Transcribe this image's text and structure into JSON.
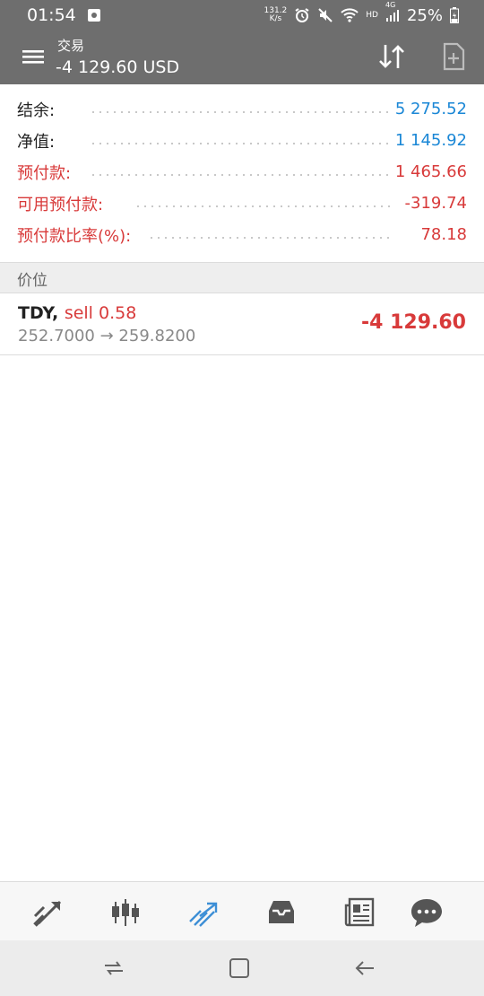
{
  "status_bar": {
    "time": "01:54",
    "net_speed_value": "131.2",
    "net_speed_unit": "K/s",
    "hd_label": "HD",
    "network_label": "4G",
    "battery": "25%"
  },
  "app_bar": {
    "title": "交易",
    "subtitle": "-4 129.60 USD"
  },
  "summary": {
    "rows": [
      {
        "label": "结余:",
        "value": "5 275.52"
      },
      {
        "label": "净值:",
        "value": "1 145.92"
      },
      {
        "label": "预付款:",
        "value": "1 465.66"
      },
      {
        "label": "可用预付款:",
        "value": "-319.74"
      },
      {
        "label": "预付款比率(%):",
        "value": "78.18"
      }
    ]
  },
  "section": {
    "title": "价位"
  },
  "positions": [
    {
      "symbol": "TDY,",
      "type": "sell 0.58",
      "prices": "252.7000 → 259.8200",
      "profit": "-4 129.60"
    }
  ],
  "bottom_nav": {
    "items": [
      {
        "name": "quotes",
        "icon": "quotes-arrows-icon"
      },
      {
        "name": "chart",
        "icon": "candlestick-icon"
      },
      {
        "name": "trade",
        "icon": "trade-trend-icon",
        "active": true
      },
      {
        "name": "history",
        "icon": "inbox-icon"
      },
      {
        "name": "news",
        "icon": "newspaper-icon"
      },
      {
        "name": "chat",
        "icon": "chat-bubble-icon"
      }
    ]
  },
  "colors": {
    "header_bg": "#6e6e6e",
    "positive_blue": "#1a87d6",
    "negative_red": "#d83a3a",
    "active_nav": "#3d8fd6",
    "inactive_nav": "#555555"
  }
}
